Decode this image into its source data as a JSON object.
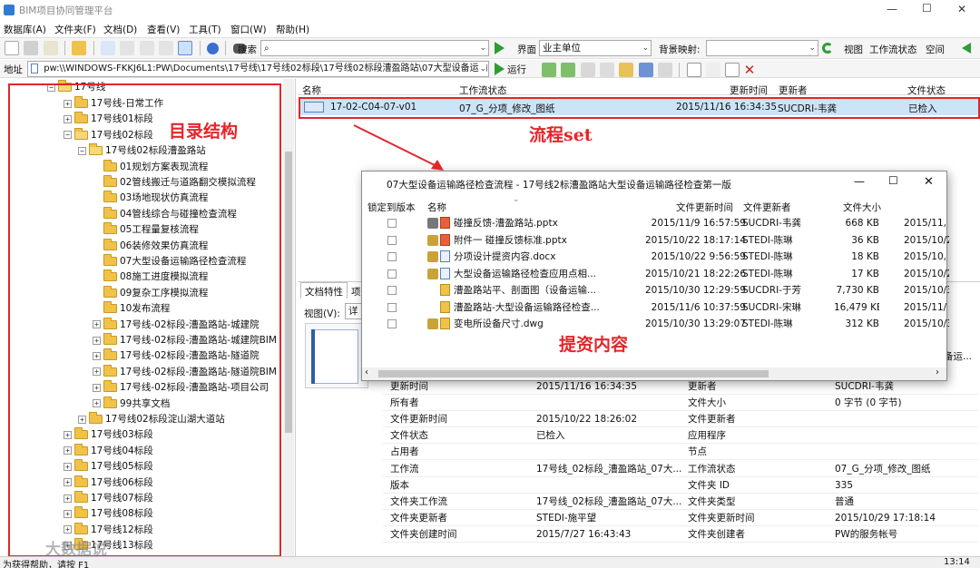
{
  "window": {
    "title": "BIM项目协同管理平台",
    "min": "—",
    "max": "☐",
    "close": "✕"
  },
  "menu": [
    "数据库(A)",
    "文件夹(F)",
    "文档(D)",
    "查看(V)",
    "工具(T)",
    "窗口(W)",
    "帮助(H)"
  ],
  "toolbar": {
    "search_label": "搜索",
    "search_value": "",
    "interface_label": "界面",
    "interface_value": "业主单位",
    "bg_label": "背景映射:",
    "bg_value": "",
    "view_label": "视图",
    "workflow_label": "工作流状态",
    "space_label": "空间"
  },
  "address": {
    "label": "地址",
    "value": "pw:\\\\WINDOWS-FKKJ6L1:PW\\Documents\\17号线\\17号线02标段\\17号线02标段漕盈路站\\07大型设备运输",
    "run_label": "运行"
  },
  "tree": {
    "root": "17号线",
    "items": [
      {
        "label": "17号线-日常工作",
        "level": 1,
        "icon": "plus"
      },
      {
        "label": "17号线01标段",
        "level": 1,
        "icon": "plus"
      },
      {
        "label": "17号线02标段",
        "level": 1,
        "icon": "minus"
      },
      {
        "label": "17号线02标段漕盈路站",
        "level": 2,
        "icon": "minus"
      },
      {
        "label": "01规划方案表现流程",
        "level": 3,
        "icon": "none"
      },
      {
        "label": "02管线搬迁与道路翻交模拟流程",
        "level": 3,
        "icon": "none"
      },
      {
        "label": "03场地现状仿真流程",
        "level": 3,
        "icon": "none"
      },
      {
        "label": "04管线综合与碰撞检查流程",
        "level": 3,
        "icon": "none"
      },
      {
        "label": "05工程量复核流程",
        "level": 3,
        "icon": "none"
      },
      {
        "label": "06装修效果仿真流程",
        "level": 3,
        "icon": "none"
      },
      {
        "label": "07大型设备运输路径检查流程",
        "level": 3,
        "icon": "none"
      },
      {
        "label": "08施工进度模拟流程",
        "level": 3,
        "icon": "none"
      },
      {
        "label": "09复杂工序模拟流程",
        "level": 3,
        "icon": "none"
      },
      {
        "label": "10发布流程",
        "level": 3,
        "icon": "none"
      },
      {
        "label": "17号线-02标段-漕盈路站-城建院",
        "level": 3,
        "icon": "plus"
      },
      {
        "label": "17号线-02标段-漕盈路站-城建院BIM",
        "level": 3,
        "icon": "plus"
      },
      {
        "label": "17号线-02标段-漕盈路站-隧道院",
        "level": 3,
        "icon": "plus"
      },
      {
        "label": "17号线-02标段-漕盈路站-隧道院BIM",
        "level": 3,
        "icon": "plus"
      },
      {
        "label": "17号线-02标段-漕盈路站-项目公司",
        "level": 3,
        "icon": "plus"
      },
      {
        "label": "99共享文档",
        "level": 3,
        "icon": "plus"
      },
      {
        "label": "17号线02标段淀山湖大道站",
        "level": 2,
        "icon": "plus"
      },
      {
        "label": "17号线03标段",
        "level": 1,
        "icon": "plus"
      },
      {
        "label": "17号线04标段",
        "level": 1,
        "icon": "plus"
      },
      {
        "label": "17号线05标段",
        "level": 1,
        "icon": "plus"
      },
      {
        "label": "17号线06标段",
        "level": 1,
        "icon": "plus"
      },
      {
        "label": "17号线07标段",
        "level": 1,
        "icon": "plus"
      },
      {
        "label": "17号线08标段",
        "level": 1,
        "icon": "plus"
      },
      {
        "label": "17号线12标段",
        "level": 1,
        "icon": "plus"
      },
      {
        "label": "17号线13标段",
        "level": 1,
        "icon": "plus"
      }
    ]
  },
  "annotations": {
    "tree": "目录结构",
    "flow": "流程set",
    "docs": "提资内容"
  },
  "filelist": {
    "headers": [
      "名称",
      "工作流状态",
      "更新时间",
      "更新者",
      "文件状态"
    ],
    "row": {
      "name": "17-02-C04-07-v01",
      "state": "07_G_分项_修改_图纸",
      "time": "2015/11/16 16:34:35",
      "user": "SUCDRI-韦龚",
      "status": "已检入"
    }
  },
  "tabs": {
    "attr": "文档特性",
    "other": "项"
  },
  "view_label": "视图(V):",
  "view_value": "详",
  "properties": [
    {
      "k1": "更新时间",
      "v1": "2015/11/16 16:34:35",
      "k2": "更新者",
      "v2": "SUCDRI-韦龚"
    },
    {
      "k1": "所有者",
      "v1": "",
      "k2": "文件大小",
      "v2": "0 字节 (0 字节)"
    },
    {
      "k1": "文件更新时间",
      "v1": "2015/10/22 18:26:02",
      "k2": "文件更新者",
      "v2": ""
    },
    {
      "k1": "文件状态",
      "v1": "已检入",
      "k2": "应用程序",
      "v2": ""
    },
    {
      "k1": "占用者",
      "v1": "",
      "k2": "节点",
      "v2": ""
    },
    {
      "k1": "工作流",
      "v1": "17号线_02标段_漕盈路站_07大...",
      "k2": "工作流状态",
      "v2": "07_G_分项_修改_图纸"
    },
    {
      "k1": "版本",
      "v1": "",
      "k2": "文件夹 ID",
      "v2": "335"
    },
    {
      "k1": "文件夹工作流",
      "v1": "17号线_02标段_漕盈路站_07大...",
      "k2": "文件夹类型",
      "v2": "普通"
    },
    {
      "k1": "文件夹更新者",
      "v1": "STEDI-施平望",
      "k2": "文件夹更新时间",
      "v2": "2015/10/29 17:18:14"
    },
    {
      "k1": "文件夹创建时间",
      "v1": "2015/7/27 16:43:43",
      "k2": "文件夹创建者",
      "v2": "PW的服务帐号"
    }
  ],
  "right_snip": "备运...",
  "dialog": {
    "title": "07大型设备运输路径检查流程 - 17号线2标漕盈路站大型设备运输路径检查第一版",
    "headers": [
      "锁定到版本",
      "名称",
      "文件更新时间",
      "文件更新者",
      "文件大小"
    ],
    "rows": [
      {
        "name": "碰撞反馈-漕盈路站.pptx",
        "time": "2015/11/9 16:57:59",
        "user": "SUCDRI-韦龚",
        "size": "668 KB",
        "extra": "2015/11,",
        "type": "ppt"
      },
      {
        "name": "附件一 碰撞反馈标准.pptx",
        "time": "2015/10/22 18:17:14",
        "user": "STEDI-陈琳",
        "size": "36 KB",
        "extra": "2015/10/2",
        "type": "ppt"
      },
      {
        "name": "分项设计提资内容.docx",
        "time": "2015/10/22 9:56:59",
        "user": "STEDI-陈琳",
        "size": "18 KB",
        "extra": "2015/10,",
        "type": "doc"
      },
      {
        "name": "大型设备运输路径检查应用点相...",
        "time": "2015/10/21 18:22:26",
        "user": "STEDI-陈琳",
        "size": "17 KB",
        "extra": "2015/10/2",
        "type": "doc"
      },
      {
        "name": "漕盈路站平、剖面图（设备运输...",
        "time": "2015/10/30 12:29:59",
        "user": "SUCDRI-于芳",
        "size": "7,730 KB",
        "extra": "2015/10/3",
        "type": "dwg"
      },
      {
        "name": "漕盈路站-大型设备运输路径检查...",
        "time": "2015/11/6 10:37:59",
        "user": "SUCDRI-宋琳",
        "size": "16,479 KB",
        "extra": "2015/11/",
        "type": "dwg"
      },
      {
        "name": "变电所设备尺寸.dwg",
        "time": "2015/10/30 13:29:07",
        "user": "STEDI-陈琳",
        "size": "312 KB",
        "extra": "2015/10/3",
        "type": "dwg"
      }
    ]
  },
  "status": {
    "help": "为获得帮助，请按 F1",
    "time": "13:14"
  },
  "watermark": "大数据说",
  "colors": {
    "accent": "#e2262a",
    "selection": "#cce4f7"
  }
}
